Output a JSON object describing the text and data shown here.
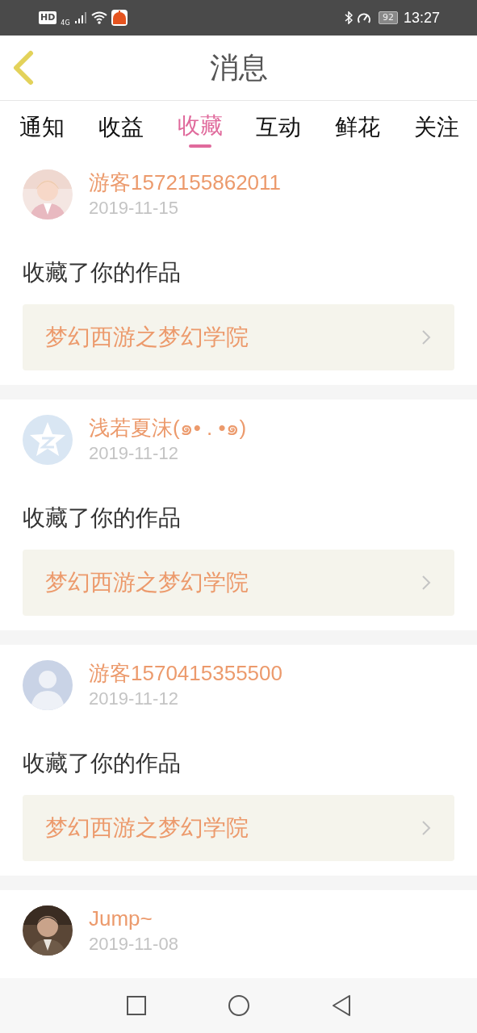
{
  "status_bar": {
    "hd": "HD",
    "network": "4G",
    "battery": "92",
    "time": "13:27"
  },
  "header": {
    "title": "消息"
  },
  "tabs": [
    {
      "label": "通知",
      "selected": false
    },
    {
      "label": "收益",
      "selected": false
    },
    {
      "label": "收藏",
      "selected": true
    },
    {
      "label": "互动",
      "selected": false
    },
    {
      "label": "鲜花",
      "selected": false
    },
    {
      "label": "关注",
      "selected": false
    }
  ],
  "messages": [
    {
      "name": "游客1572155862011",
      "date": "2019-11-15",
      "action": "收藏了你的作品",
      "work": "梦幻西游之梦幻学院"
    },
    {
      "avatar": {
        "kind": "star"
      },
      "name": "浅若夏沫(๑• . •๑)",
      "date": "2019-11-12",
      "action": "收藏了你的作品",
      "work": "梦幻西游之梦幻学院"
    },
    {
      "avatar": {
        "kind": "default"
      },
      "name": "游客1570415355500",
      "date": "2019-11-12",
      "action": "收藏了你的作品",
      "work": "梦幻西游之梦幻学院"
    },
    {
      "name": "Jump~",
      "date": "2019-11-08"
    }
  ]
}
